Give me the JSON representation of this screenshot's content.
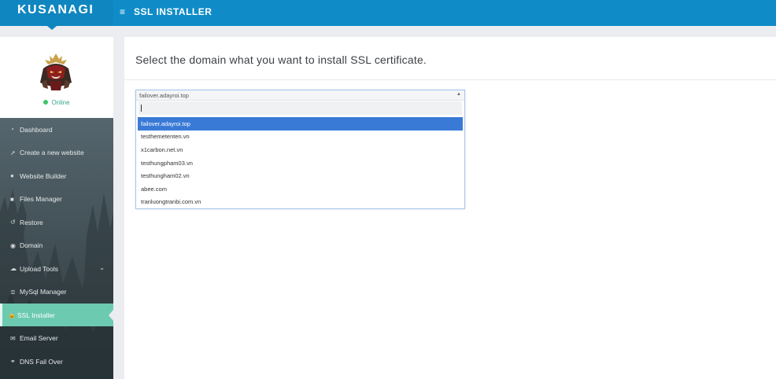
{
  "app": {
    "logo": "KUSANAGI",
    "page_title": "SSL INSTALLER",
    "menu_icon": "≡"
  },
  "profile": {
    "status": "Online"
  },
  "sidebar": {
    "items": [
      {
        "label": "Dashboard",
        "icon": "dashboard-icon",
        "glyph": "◔"
      },
      {
        "label": "Create a new website",
        "icon": "rocket-icon",
        "glyph": "➚"
      },
      {
        "label": "Website Builder",
        "icon": "builder-icon",
        "glyph": "●"
      },
      {
        "label": "Files Manager",
        "icon": "folder-icon",
        "glyph": "■"
      },
      {
        "label": "Restore",
        "icon": "restore-icon",
        "glyph": "↺"
      },
      {
        "label": "Domain",
        "icon": "globe-icon",
        "glyph": "◉"
      },
      {
        "label": "Upload Tools",
        "icon": "cloud-upload-icon",
        "glyph": "☁"
      },
      {
        "label": "MySql Manager",
        "icon": "database-icon",
        "glyph": "≣"
      },
      {
        "label": "SSL Installer",
        "icon": "lock-icon",
        "glyph": "🔒"
      },
      {
        "label": "Email Server",
        "icon": "envelope-icon",
        "glyph": "✉"
      },
      {
        "label": "DNS Fail Over",
        "icon": "link-icon",
        "glyph": "⚭"
      }
    ],
    "active_index": 8
  },
  "main": {
    "heading": "Select the domain what you want to install SSL certificate.",
    "select": {
      "current": "failover.adayroi.top",
      "search_value": "",
      "options": [
        "failover.adayroi.top",
        "testhemetenten.vn",
        "x1carbon.net.vn",
        "testhungpham03.vn",
        "testhungham02.vn",
        "abee.com",
        "tranluongtranbi.com.vn"
      ],
      "highlighted_index": 0
    }
  },
  "colors": {
    "topbar": "#0f8cc8",
    "active_nav": "#6ccab0",
    "option_highlight": "#3a7ad7"
  }
}
